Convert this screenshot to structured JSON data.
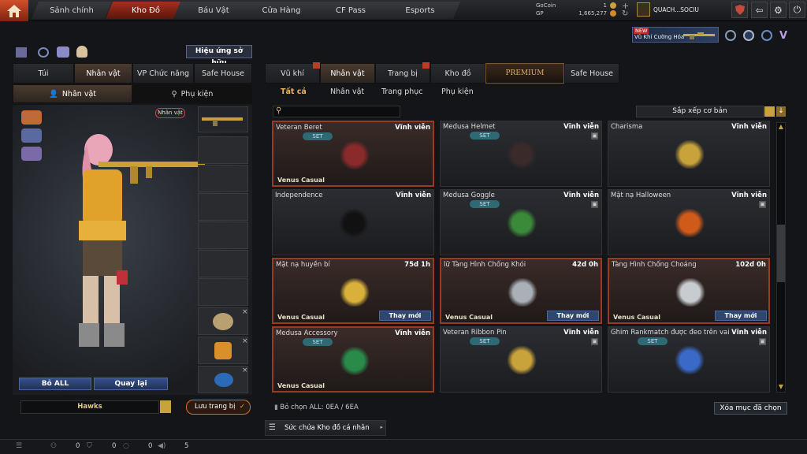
{
  "nav": {
    "tabs": [
      "Sảnh chính",
      "Kho Đồ",
      "Báu Vật",
      "Cửa Hàng",
      "CF Pass",
      "Esports"
    ]
  },
  "currency": {
    "gocoin_label": "GoCoin",
    "gocoin_value": "1",
    "gp_label": "GP",
    "gp_value": "1,665,277"
  },
  "user": {
    "name": "QUACH...SOCIU"
  },
  "promo": {
    "badge": "NEW",
    "text": "Vũ Khí Cường Hóa"
  },
  "left": {
    "effect_button": "Hiệu ứng sở hữu",
    "tabs": [
      "Túi",
      "Nhân vật",
      "VP Chức năng",
      "Safe House"
    ],
    "subtabs": [
      "Nhân vật",
      "Phụ kiện"
    ],
    "char_badge": "Nhân vật",
    "remove_all": "Bỏ ALL",
    "back": "Quay lại",
    "preset_name": "Hawks",
    "save_label": "Lưu trang bị"
  },
  "right": {
    "tabs": [
      "Vũ khí",
      "Nhân vật",
      "Trang bị",
      "Kho đồ",
      "PREMIUM",
      "Safe House"
    ],
    "subtabs": [
      "Tất cả",
      "Nhân vật",
      "Trang phục",
      "Phụ kiện"
    ],
    "search_placeholder": "",
    "sort_label": "Sắp xếp cơ bản",
    "deselect_info": "Bỏ chọn ALL: 0EA / 6EA",
    "delete_selected": "Xóa mục đã chọn",
    "capacity_label": "Sức chứa Kho đồ cá nhân"
  },
  "items": [
    {
      "name": "Veteran Beret",
      "duration": "Vĩnh viễn",
      "set": "SET",
      "tag": "Venus Casual",
      "action": "",
      "sel": true,
      "icon": "beret-icon"
    },
    {
      "name": "Medusa Helmet",
      "duration": "Vĩnh viễn",
      "set": "SET",
      "tag": "",
      "action": "",
      "sel": false,
      "icon": "helmet-icon"
    },
    {
      "name": "Charisma",
      "duration": "Vĩnh viễn",
      "set": "",
      "tag": "",
      "action": "",
      "sel": false,
      "icon": "aviator-glasses-icon"
    },
    {
      "name": "Independence",
      "duration": "Vĩnh viễn",
      "set": "",
      "tag": "",
      "action": "",
      "sel": false,
      "icon": "sunglasses-icon"
    },
    {
      "name": "Medusa Goggle",
      "duration": "Vĩnh viễn",
      "set": "SET",
      "tag": "",
      "action": "",
      "sel": false,
      "icon": "goggle-icon"
    },
    {
      "name": "Mặt nạ Halloween",
      "duration": "Vĩnh viễn",
      "set": "",
      "tag": "",
      "action": "",
      "sel": false,
      "icon": "halloween-mask-icon"
    },
    {
      "name": "Mặt nạ huyền bí",
      "duration": "75d 1h",
      "set": "",
      "tag": "Venus Casual",
      "action": "Thay mới",
      "sel": true,
      "icon": "gold-mask-icon"
    },
    {
      "name": "lữ Tàng Hình Chống Khói",
      "duration": "42d 0h",
      "set": "",
      "tag": "Venus Casual",
      "action": "Thay mới",
      "sel": true,
      "icon": "clear-helmet-icon"
    },
    {
      "name": "Tàng Hình Chống Choáng",
      "duration": "102d 0h",
      "set": "",
      "tag": "Venus Casual",
      "action": "Thay mới",
      "sel": true,
      "icon": "clear-glasses-icon"
    },
    {
      "name": "Medusa Accessory",
      "duration": "Vĩnh viễn",
      "set": "SET",
      "tag": "Venus Casual",
      "action": "",
      "sel": true,
      "icon": "emerald-accessory-icon"
    },
    {
      "name": "Veteran Ribbon Pin",
      "duration": "Vĩnh viễn",
      "set": "SET",
      "tag": "",
      "action": "",
      "sel": false,
      "icon": "ribbon-pin-icon"
    },
    {
      "name": "Ghim Rankmatch được đeo trên vai",
      "duration": "Vĩnh viễn",
      "set": "SET",
      "tag": "",
      "action": "",
      "sel": false,
      "icon": "rank-pin-icon"
    }
  ],
  "status": {
    "v1": "0",
    "v2": "0",
    "v3": "0",
    "v4": "5"
  }
}
